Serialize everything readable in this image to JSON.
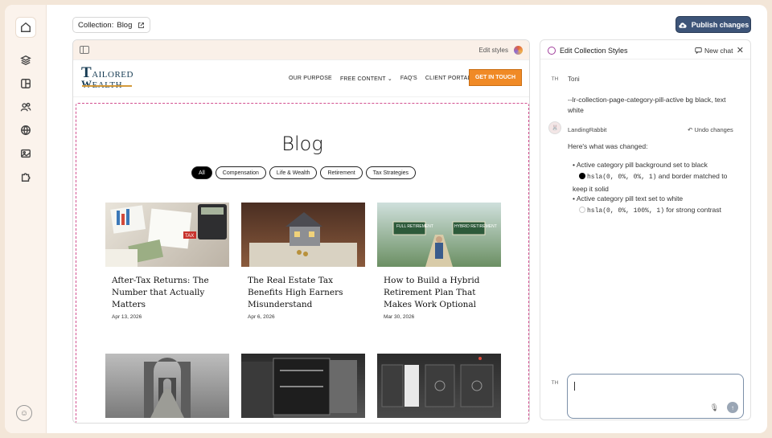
{
  "topbar": {
    "collection_label": "Collection:",
    "collection_name": "Blog",
    "publish_label": "Publish changes"
  },
  "preview": {
    "edit_styles_label": "Edit styles",
    "site": {
      "logo_top": "AILORED",
      "logo_bottom": "EALTH",
      "nav": [
        "OUR PURPOSE",
        "FREE CONTENT",
        "FAQ'S",
        "CLIENT PORTAL"
      ],
      "cta": "GET IN TOUCH"
    },
    "blog": {
      "title": "Blog",
      "categories": [
        "All",
        "Compensation",
        "Life & Wealth",
        "Retirement",
        "Tax Strategies"
      ],
      "active_category": "All",
      "posts": [
        {
          "title": "After-Tax Returns: The Number that Actually Matters",
          "date": "Apr 13, 2026",
          "image": "tax-documents-calculator"
        },
        {
          "title": "The Real Estate Tax Benefits High Earners Misunderstand",
          "date": "Apr 6, 2026",
          "image": "house-model-keys"
        },
        {
          "title": "How to Build a Hybrid Retirement Plan That Makes Work Optional",
          "date": "Mar 30, 2026",
          "image": "full-vs-hybrid-retirement-signs"
        },
        {
          "title": "",
          "date": "",
          "image": "stone-archways-path"
        },
        {
          "title": "",
          "date": "",
          "image": "open-vault-safe"
        },
        {
          "title": "",
          "date": "",
          "image": "row-of-vault-doors"
        }
      ]
    },
    "sign_texts": {
      "full": "FULL RETIREMENT",
      "hybrid": "HYBRID RETIREMENT",
      "tax": "TAX"
    }
  },
  "chat": {
    "title": "Edit Collection Styles",
    "new_chat": "New chat",
    "user": {
      "initials": "TH",
      "name": "Toni",
      "message": "--lr-collection-page-category-pill-active bg black, text white"
    },
    "assistant": {
      "name": "LandingRabbit",
      "undo": "Undo changes",
      "intro": "Here's what was changed:",
      "items": [
        {
          "pre": "Active category pill background set to black",
          "code": "hsla(0, 0%, 0%, 1)",
          "post": "and border matched to keep it solid",
          "color": "#000000"
        },
        {
          "pre": "Active category pill text set to white",
          "code": "hsla(0, 0%, 100%, 1)",
          "post": "for strong contrast",
          "color": "#ffffff"
        }
      ]
    },
    "composer_initials": "TH"
  },
  "colors": {
    "publish": "#3d5478",
    "cta": "#f08a26",
    "dashed": "#d24f8f"
  }
}
